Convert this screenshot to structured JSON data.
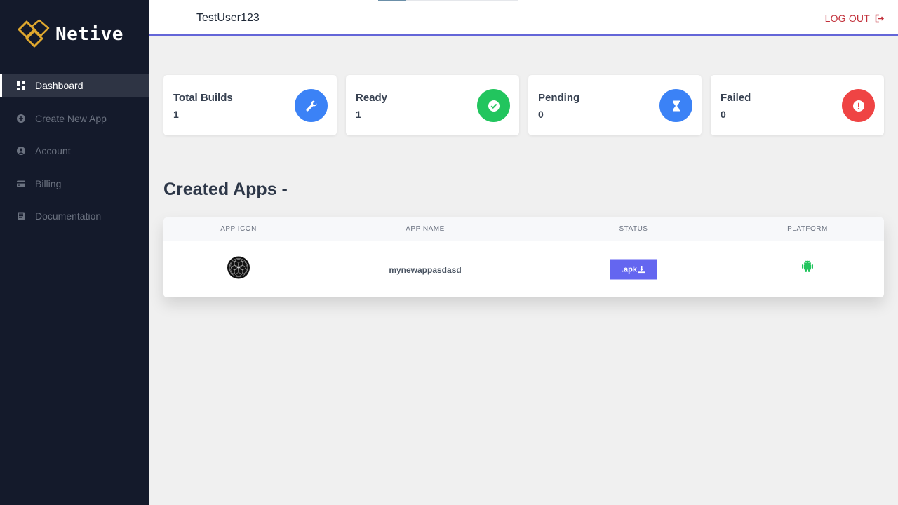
{
  "brand": {
    "name": "Netive",
    "logo_icon": "netive-logo-icon",
    "accent": "#e0a82e"
  },
  "sidebar": {
    "items": [
      {
        "label": "Dashboard",
        "icon": "dashboard-icon",
        "active": true
      },
      {
        "label": "Create New App",
        "icon": "plus-circle-icon",
        "active": false
      },
      {
        "label": "Account",
        "icon": "user-circle-icon",
        "active": false
      },
      {
        "label": "Billing",
        "icon": "credit-card-icon",
        "active": false
      },
      {
        "label": "Documentation",
        "icon": "book-icon",
        "active": false
      }
    ]
  },
  "header": {
    "username": "TestUser123",
    "logout_label": "LOG OUT",
    "logout_icon": "logout-icon",
    "accent": "#6466d8"
  },
  "stats": [
    {
      "title": "Total Builds",
      "value": "1",
      "icon": "wrench-icon",
      "color": "#3b82f6"
    },
    {
      "title": "Ready",
      "value": "1",
      "icon": "check-circle-icon",
      "color": "#22c55e"
    },
    {
      "title": "Pending",
      "value": "0",
      "icon": "hourglass-icon",
      "color": "#3b82f6"
    },
    {
      "title": "Failed",
      "value": "0",
      "icon": "exclamation-icon",
      "color": "#ef4444"
    }
  ],
  "created_apps": {
    "title": "Created Apps -",
    "columns": [
      "APP ICON",
      "APP NAME",
      "STATUS",
      "PLATFORM"
    ],
    "rows": [
      {
        "app_icon": "app-logo-icon",
        "app_name": "mynewappasdasd",
        "status_label": ".apk",
        "status_icon": "download-icon",
        "platform_icon": "android-icon"
      }
    ],
    "button_color": "#6466f0",
    "android_color": "#22c55e"
  }
}
